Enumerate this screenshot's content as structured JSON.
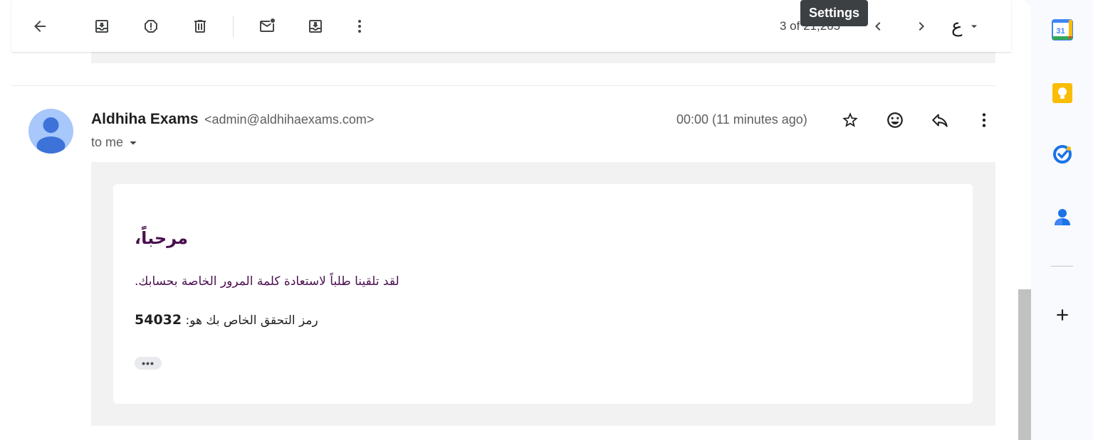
{
  "toolbar": {
    "back_icon": "arrow-left-icon",
    "archive_icon": "archive-icon",
    "report_spam_icon": "report-icon",
    "delete_icon": "trash-icon",
    "mark_unread_icon": "mail-unread-icon",
    "move_to_icon": "move-to-inbox-icon",
    "more_icon": "more-vert-icon",
    "page_count": "3 of 21,265",
    "prev_icon": "chevron-left-icon",
    "next_icon": "chevron-right-icon",
    "input_tool_glyph": "ع",
    "input_tool_dropdown_icon": "caret-down-icon"
  },
  "tooltip": {
    "text": "Settings"
  },
  "message": {
    "sender_name": "Aldhiha Exams",
    "sender_email": "<admin@aldhihaexams.com>",
    "recipient": "to me",
    "timestamp": "00:00 (11 minutes ago)",
    "actions": [
      "star-icon",
      "emoji-icon",
      "reply-icon",
      "more-vert-icon"
    ],
    "body": {
      "greeting": "مرحباً،",
      "line1": "لقد تلقينا طلباً لاستعادة كلمة المرور الخاصة بحسابك.",
      "code_label": "رمز التحقق الخاص بك هو:",
      "code": "54032",
      "trimmed_content_label": "•••"
    }
  },
  "side_panel": {
    "apps": [
      "calendar-icon",
      "keep-icon",
      "tasks-icon",
      "contacts-icon"
    ],
    "calendar_day": "31",
    "add_icon": "plus-icon"
  },
  "colors": {
    "accent_purple": "#4a0f4f",
    "avatar_bg": "#a8c7fa",
    "avatar_fg": "#3d72d9",
    "tooltip_bg": "#3c4043"
  }
}
